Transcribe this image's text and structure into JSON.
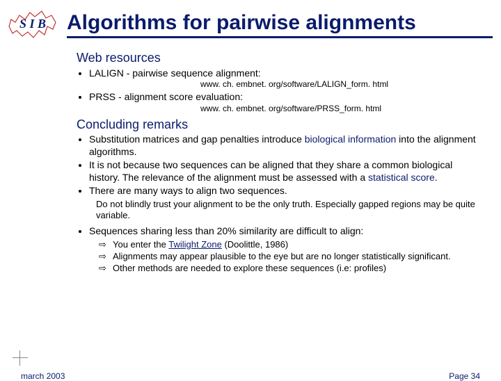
{
  "logo_text": "S I B",
  "title": "Algorithms for pairwise alignments",
  "sections": {
    "web": {
      "heading": "Web resources",
      "items": [
        {
          "label": "LALIGN - pairwise sequence alignment:",
          "url": "www. ch. embnet. org/software/LALIGN_form. html"
        },
        {
          "label": "PRSS - alignment score evaluation:",
          "url": "www. ch. embnet. org/software/PRSS_form. html"
        }
      ]
    },
    "concl": {
      "heading": "Concluding remarks",
      "b1a": "Substitution matrices and gap penalties introduce ",
      "b1b": "biological information",
      "b1c": " into the alignment algorithms.",
      "b2a": "It is not because two sequences can be aligned that they share a common biological history. The relevance of the alignment must be assessed with a ",
      "b2b": "statistical score",
      "b2c": ".",
      "b3": "There are many ways to align two sequences.",
      "advice": "Do not blindly trust your alignment to be the only truth. Especially gapped regions may be quite variable.",
      "b4": "Sequences sharing less than 20% similarity are difficult to align:",
      "a1a": "You enter the ",
      "a1b": "Twilight Zone",
      "a1c": " (Doolittle, 1986)",
      "a2": "Alignments may appear plausible to the eye but are no longer statistically significant.",
      "a3": "Other methods are needed to explore these sequences (i.e: profiles)"
    }
  },
  "footer": {
    "date": "march 2003",
    "page": "Page 34"
  }
}
